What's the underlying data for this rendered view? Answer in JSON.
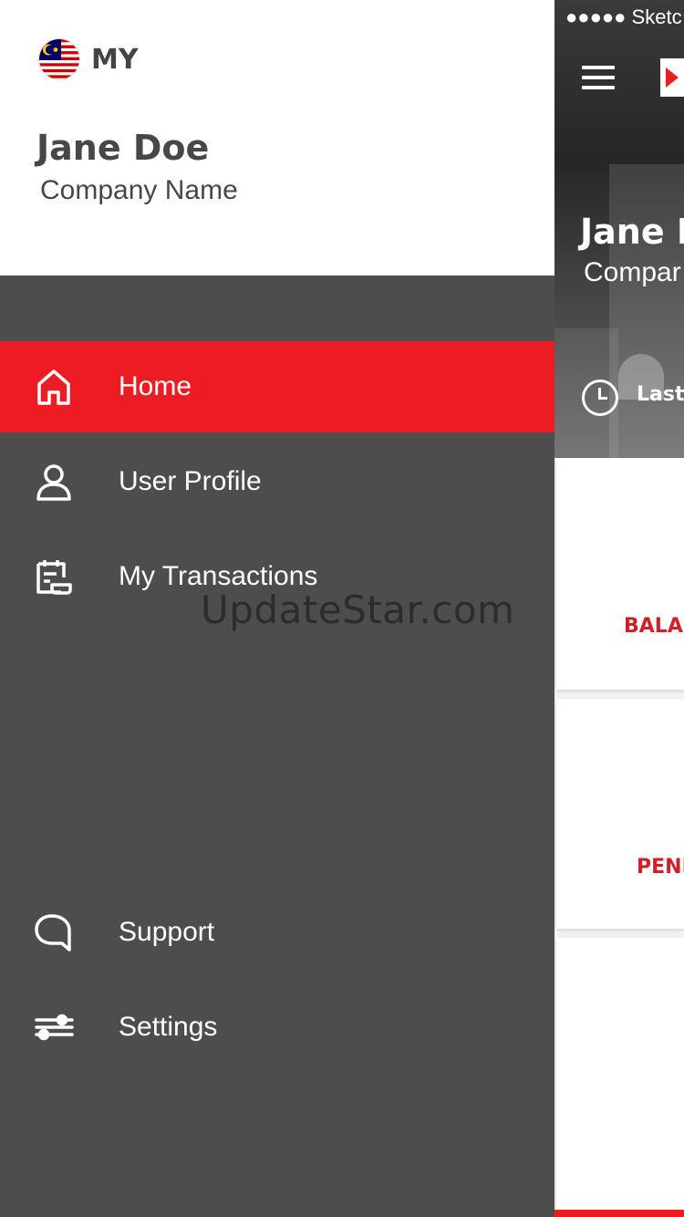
{
  "drawer": {
    "country_code": "MY",
    "user_name": "Jane Doe",
    "company_name": "Company Name",
    "nav_items": [
      {
        "label": "Home",
        "icon": "home-icon",
        "active": true
      },
      {
        "label": "User Profile",
        "icon": "user-icon",
        "active": false
      },
      {
        "label": "My Transactions",
        "icon": "transactions-icon",
        "active": false
      }
    ],
    "bottom_items": [
      {
        "label": "Support",
        "icon": "chat-bubble-icon"
      },
      {
        "label": "Settings",
        "icon": "sliders-icon"
      }
    ]
  },
  "watermark": "UpdateStar.com",
  "main": {
    "status_bar": "●●●●● Sketc",
    "hero_name": "Jane D",
    "hero_company": "Compar",
    "last_label": "Last",
    "cards": [
      {
        "label": "BALAI"
      },
      {
        "label": "PENI"
      }
    ]
  },
  "colors": {
    "accent": "#ec1c24",
    "drawer_bg": "#4d4d4d",
    "header_bg": "#ffffff",
    "card_label": "#d0202a"
  }
}
